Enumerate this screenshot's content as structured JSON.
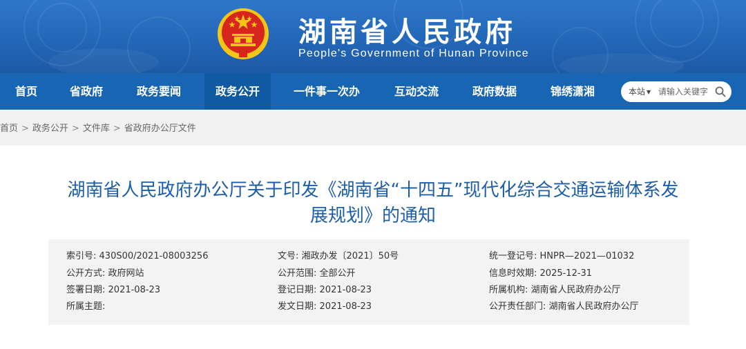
{
  "header": {
    "site_title": "湖南省人民政府",
    "site_subtitle": "People's Government of Hunan Province",
    "emblem_icon": "national-emblem-icon",
    "colors": {
      "header_blue": "#2367b8",
      "nav_blue": "#1866b3",
      "title_blue": "#1d5ea8",
      "emblem_red": "#d7261e",
      "emblem_gold": "#f5c518"
    }
  },
  "nav": {
    "items": [
      {
        "label": "首页"
      },
      {
        "label": "省政府"
      },
      {
        "label": "政务要闻"
      },
      {
        "label": "政务公开"
      },
      {
        "label": "一件事一次办"
      },
      {
        "label": "互动交流"
      },
      {
        "label": "政府数据"
      },
      {
        "label": "锦绣潇湘"
      }
    ],
    "active_label": "政务公开"
  },
  "search": {
    "scope_label": "本站",
    "placeholder": "请输入关键字",
    "icon": "search-icon"
  },
  "breadcrumb": {
    "items": [
      "首页",
      "政务公开",
      "文件库",
      "省政府办公厅文件"
    ],
    "separator": ">"
  },
  "document": {
    "title_line1": "湖南省人民政府办公厅关于印发《湖南省“十四五”现代化综合交通运输体系发",
    "title_line2": "展规划》的通知",
    "meta": {
      "rows": [
        [
          {
            "label": "索引号:",
            "value": "430S00/2021-08003256"
          },
          {
            "label": "文号:",
            "value": "湘政办发〔2021〕50号"
          },
          {
            "label": "统一登记号:",
            "value": "HNPR—2021—01032"
          }
        ],
        [
          {
            "label": "公开方式:",
            "value": "政府网站"
          },
          {
            "label": "公开范围:",
            "value": "全部公开"
          },
          {
            "label": "信息时效期:",
            "value": "2025-12-31"
          }
        ],
        [
          {
            "label": "签署日期:",
            "value": "2021-08-23"
          },
          {
            "label": "登记日期:",
            "value": "2021-08-23"
          },
          {
            "label": "所属机构:",
            "value": "湖南省人民政府办公厅"
          }
        ],
        [
          {
            "label": "所属主题:",
            "value": ""
          },
          {
            "label": "发文日期:",
            "value": "2021-08-23"
          },
          {
            "label": "公开责任部门:",
            "value": "湖南省人民政府办公厅"
          }
        ]
      ]
    }
  }
}
